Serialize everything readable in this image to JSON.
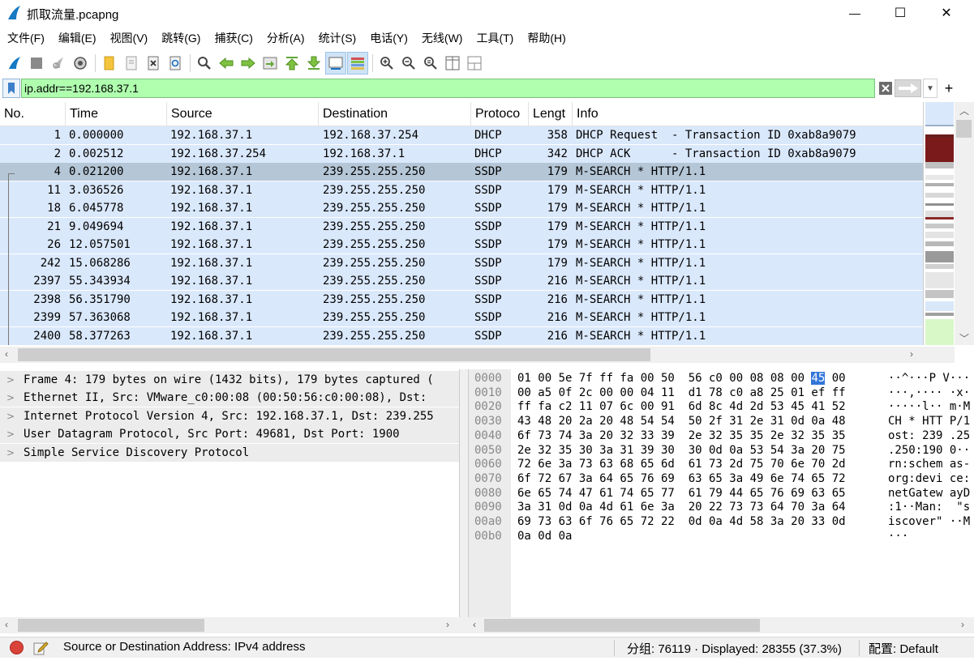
{
  "window": {
    "title": "抓取流量.pcapng",
    "minimize_glyph": "—",
    "maximize_glyph": "☐",
    "close_glyph": "✕"
  },
  "menu": [
    "文件(F)",
    "编辑(E)",
    "视图(V)",
    "跳转(G)",
    "捕获(C)",
    "分析(A)",
    "统计(S)",
    "电话(Y)",
    "无线(W)",
    "工具(T)",
    "帮助(H)"
  ],
  "toolbar_icons": [
    "start-capture-icon",
    "stop-capture-icon",
    "restart-capture-icon",
    "capture-options-icon",
    "open-file-icon",
    "save-file-icon",
    "close-file-icon",
    "reload-file-icon",
    "find-packet-icon",
    "go-back-icon",
    "go-forward-icon",
    "go-to-packet-icon",
    "go-first-icon",
    "go-last-icon",
    "auto-scroll-icon",
    "colorize-icon",
    "zoom-in-icon",
    "zoom-out-icon",
    "zoom-normal-icon",
    "resize-columns-icon",
    "layout-icon"
  ],
  "filter": {
    "value": "ip.addr==192.168.37.1",
    "color": "#afffaf"
  },
  "packet_list": {
    "columns": [
      "No.",
      "Time",
      "Source",
      "Destination",
      "Protoco",
      "Lengt",
      "Info"
    ],
    "rows": [
      {
        "no": "1",
        "time": "0.000000",
        "src": "192.168.37.1",
        "dst": "192.168.37.254",
        "proto": "DHCP",
        "len": "358",
        "info": "DHCP Request  - Transaction ID 0xab8a9079"
      },
      {
        "no": "2",
        "time": "0.002512",
        "src": "192.168.37.254",
        "dst": "192.168.37.1",
        "proto": "DHCP",
        "len": "342",
        "info": "DHCP ACK      - Transaction ID 0xab8a9079"
      },
      {
        "no": "4",
        "time": "0.021200",
        "src": "192.168.37.1",
        "dst": "239.255.255.250",
        "proto": "SSDP",
        "len": "179",
        "info": "M-SEARCH * HTTP/1.1",
        "selected": true
      },
      {
        "no": "11",
        "time": "3.036526",
        "src": "192.168.37.1",
        "dst": "239.255.255.250",
        "proto": "SSDP",
        "len": "179",
        "info": "M-SEARCH * HTTP/1.1"
      },
      {
        "no": "18",
        "time": "6.045778",
        "src": "192.168.37.1",
        "dst": "239.255.255.250",
        "proto": "SSDP",
        "len": "179",
        "info": "M-SEARCH * HTTP/1.1"
      },
      {
        "no": "21",
        "time": "9.049694",
        "src": "192.168.37.1",
        "dst": "239.255.255.250",
        "proto": "SSDP",
        "len": "179",
        "info": "M-SEARCH * HTTP/1.1"
      },
      {
        "no": "26",
        "time": "12.057501",
        "src": "192.168.37.1",
        "dst": "239.255.255.250",
        "proto": "SSDP",
        "len": "179",
        "info": "M-SEARCH * HTTP/1.1"
      },
      {
        "no": "242",
        "time": "15.068286",
        "src": "192.168.37.1",
        "dst": "239.255.255.250",
        "proto": "SSDP",
        "len": "179",
        "info": "M-SEARCH * HTTP/1.1"
      },
      {
        "no": "2397",
        "time": "55.343934",
        "src": "192.168.37.1",
        "dst": "239.255.255.250",
        "proto": "SSDP",
        "len": "216",
        "info": "M-SEARCH * HTTP/1.1"
      },
      {
        "no": "2398",
        "time": "56.351790",
        "src": "192.168.37.1",
        "dst": "239.255.255.250",
        "proto": "SSDP",
        "len": "216",
        "info": "M-SEARCH * HTTP/1.1"
      },
      {
        "no": "2399",
        "time": "57.363068",
        "src": "192.168.37.1",
        "dst": "239.255.255.250",
        "proto": "SSDP",
        "len": "216",
        "info": "M-SEARCH * HTTP/1.1"
      },
      {
        "no": "2400",
        "time": "58.377263",
        "src": "192.168.37.1",
        "dst": "239.255.255.250",
        "proto": "SSDP",
        "len": "216",
        "info": "M-SEARCH * HTTP/1.1"
      }
    ],
    "row_color": "#dae8fb",
    "selected_color": "#b5c6d6"
  },
  "details": [
    "Frame 4: 179 bytes on wire (1432 bits), 179 bytes captured (",
    "Ethernet II, Src: VMware_c0:00:08 (00:50:56:c0:00:08), Dst: ",
    "Internet Protocol Version 4, Src: 192.168.37.1, Dst: 239.255",
    "User Datagram Protocol, Src Port: 49681, Dst Port: 1900",
    "Simple Service Discovery Protocol"
  ],
  "bytes": [
    {
      "off": "0000",
      "hex": "01 00 5e 7f ff fa 00 50  56 c0 00 08 08 00 45 00",
      "asc": "··^···P V···"
    },
    {
      "off": "0010",
      "hex": "00 a5 0f 2c 00 00 04 11  d1 78 c0 a8 25 01 ef ff",
      "asc": "···,···· ·x·"
    },
    {
      "off": "0020",
      "hex": "ff fa c2 11 07 6c 00 91  6d 8c 4d 2d 53 45 41 52",
      "asc": "·····l·· m·M"
    },
    {
      "off": "0030",
      "hex": "43 48 20 2a 20 48 54 54  50 2f 31 2e 31 0d 0a 48",
      "asc": "CH * HTT P/1"
    },
    {
      "off": "0040",
      "hex": "6f 73 74 3a 20 32 33 39  2e 32 35 35 2e 32 35 35",
      "asc": "ost: 239 .25"
    },
    {
      "off": "0050",
      "hex": "2e 32 35 30 3a 31 39 30  30 0d 0a 53 54 3a 20 75",
      "asc": ".250:190 0··"
    },
    {
      "off": "0060",
      "hex": "72 6e 3a 73 63 68 65 6d  61 73 2d 75 70 6e 70 2d",
      "asc": "rn:schem as-"
    },
    {
      "off": "0070",
      "hex": "6f 72 67 3a 64 65 76 69  63 65 3a 49 6e 74 65 72",
      "asc": "org:devi ce:"
    },
    {
      "off": "0080",
      "hex": "6e 65 74 47 61 74 65 77  61 79 44 65 76 69 63 65",
      "asc": "netGatew ayD"
    },
    {
      "off": "0090",
      "hex": "3a 31 0d 0a 4d 61 6e 3a  20 22 73 73 64 70 3a 64",
      "asc": ":1··Man:  \"s"
    },
    {
      "off": "00a0",
      "hex": "69 73 63 6f 76 65 72 22  0d 0a 4d 58 3a 20 33 0d",
      "asc": "iscover\" ··M"
    },
    {
      "off": "00b0",
      "hex": "0a 0d 0a",
      "asc": "···"
    }
  ],
  "status": {
    "message": "Source or Destination Address: IPv4 address",
    "packets": "分组: 76119 · Displayed: 28355 (37.3%)",
    "profile": "配置: Default"
  }
}
